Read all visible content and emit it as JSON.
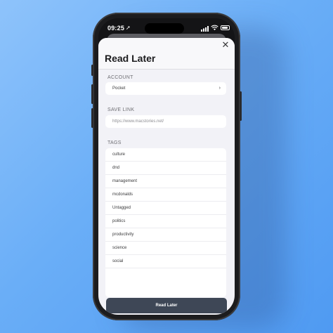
{
  "status_bar": {
    "time": "09:25"
  },
  "sheet": {
    "title": "Read Later",
    "close_glyph": "✕",
    "account": {
      "label": "ACCOUNT",
      "value": "Pocket",
      "chevron": "›"
    },
    "save_link": {
      "label": "SAVE LINK",
      "placeholder": "https://www.macstories.net/"
    },
    "tags": {
      "label": "TAGS",
      "items": [
        {
          "label": "culture"
        },
        {
          "label": "dnd"
        },
        {
          "label": "management"
        },
        {
          "label": "mcdonalds"
        },
        {
          "label": "Untagged"
        },
        {
          "label": "politics"
        },
        {
          "label": "productivity"
        },
        {
          "label": "science"
        },
        {
          "label": "social"
        }
      ]
    },
    "action_button": "Read Later"
  }
}
